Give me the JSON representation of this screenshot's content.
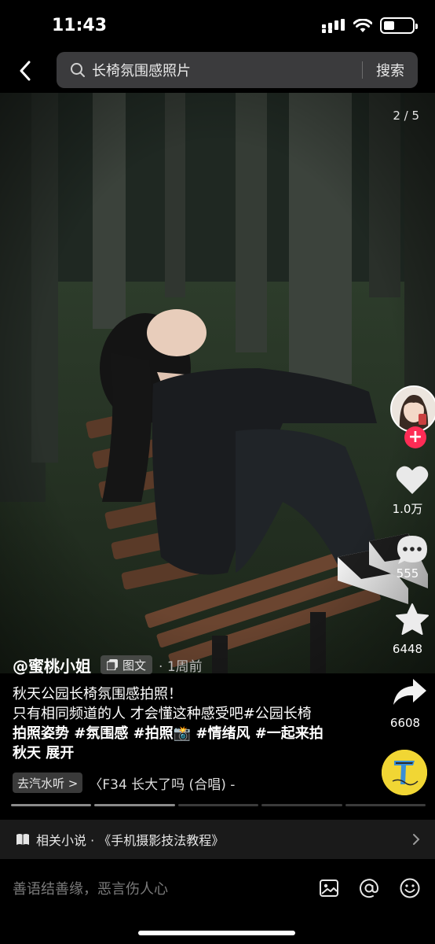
{
  "status_bar": {
    "time": "11:43",
    "battery_level": 0.35
  },
  "search": {
    "query": "长椅氛围感照片",
    "button_label": "搜索"
  },
  "photo": {
    "page_indicator": "2 / 5"
  },
  "actions": {
    "like_count": "1.0万",
    "comment_count": "555",
    "favorite_count": "6448",
    "share_count": "6608"
  },
  "post": {
    "author": "@蜜桃小姐",
    "type_tag": "图文",
    "time": "· 1周前",
    "caption_lines": [
      "秋天公园长椅氛围感拍照！",
      "只有相同频道的人 才会懂这种感受吧#公园长椅",
      "拍照姿势 #氛围感 #拍照📸 #情绪风 #一起来拍",
      "秋天  展开"
    ]
  },
  "music": {
    "tag": "去汽水听 >",
    "title": "〈F34    长大了吗 (合唱) -"
  },
  "progress": {
    "total": 5,
    "active_index": 1
  },
  "related": {
    "text": "相关小说 · 《手机摄影技法教程》"
  },
  "comment_bar": {
    "placeholder": "善语结善缘，恶言伤人心"
  },
  "colors": {
    "accent": "#fe2c55",
    "search_bg": "#3b3b3d",
    "disc": "#f1d634"
  },
  "icons": {
    "back": "chevron-left-icon",
    "search": "search-icon",
    "like": "heart-icon",
    "comment": "comment-icon",
    "favorite": "star-icon",
    "share": "share-arrow-icon",
    "book": "book-icon",
    "image": "image-icon",
    "mention": "at-icon",
    "emoji": "emoji-icon"
  }
}
